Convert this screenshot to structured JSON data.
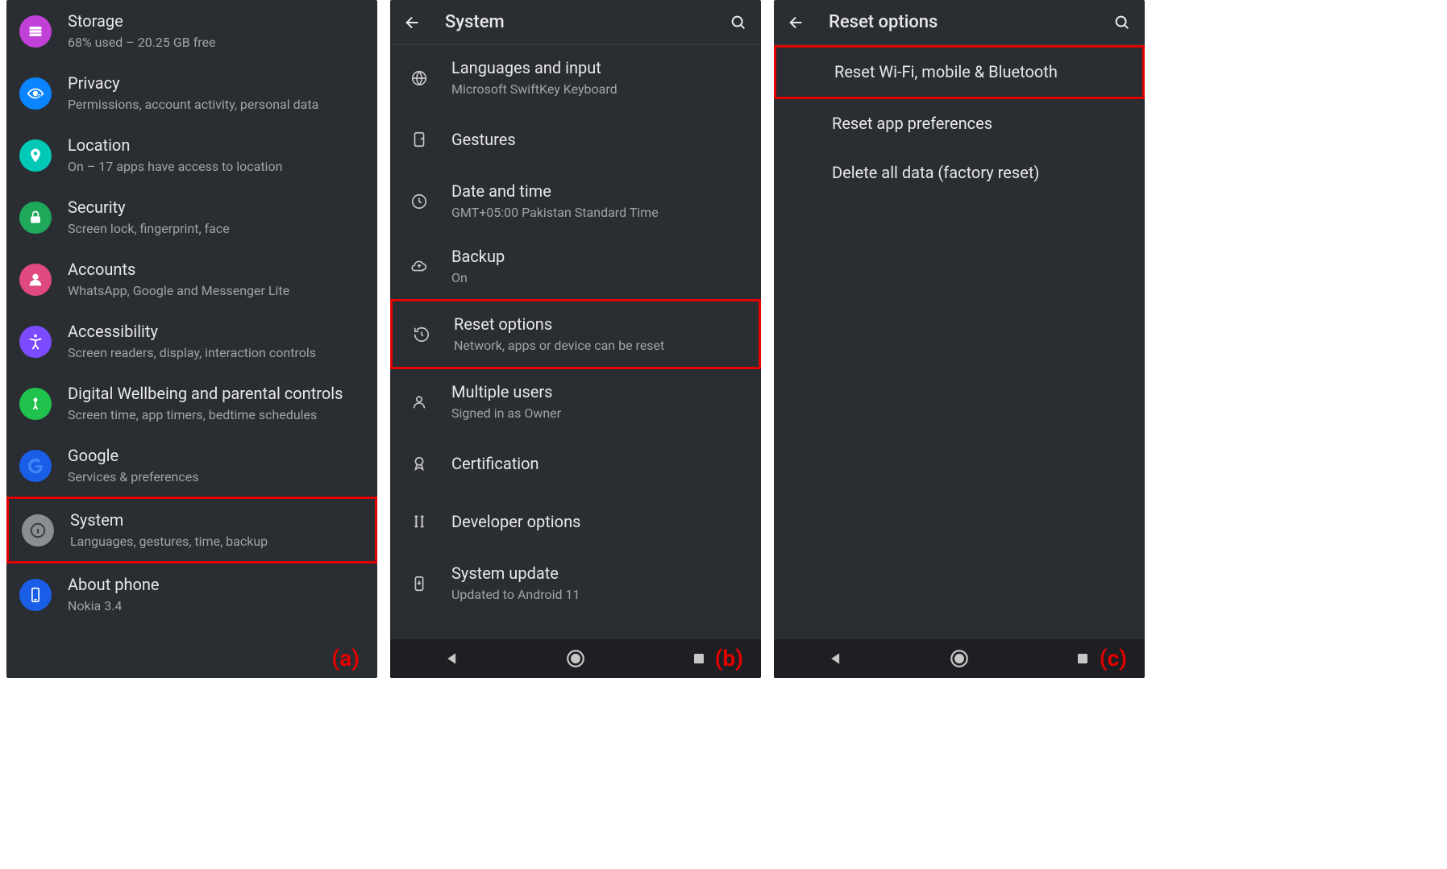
{
  "panel_a": {
    "tag": "(a)",
    "items": [
      {
        "title": "Storage",
        "sub": "68% used – 20.25 GB free",
        "icon": "storage",
        "bg": "#c040d8"
      },
      {
        "title": "Privacy",
        "sub": "Permissions, account activity, personal data",
        "icon": "privacy",
        "bg": "#0a84ff"
      },
      {
        "title": "Location",
        "sub": "On – 17 apps have access to location",
        "icon": "location",
        "bg": "#00c9b7"
      },
      {
        "title": "Security",
        "sub": "Screen lock, fingerprint, face",
        "icon": "lock",
        "bg": "#1fa85a"
      },
      {
        "title": "Accounts",
        "sub": "WhatsApp, Google and Messenger Lite",
        "icon": "account",
        "bg": "#e04980"
      },
      {
        "title": "Accessibility",
        "sub": "Screen readers, display, interaction controls",
        "icon": "accessibility",
        "bg": "#7a4bff"
      },
      {
        "title": "Digital Wellbeing and parental controls",
        "sub": "Screen time, app timers, bedtime schedules",
        "icon": "wellbeing",
        "bg": "#1fc24d"
      },
      {
        "title": "Google",
        "sub": "Services & preferences",
        "icon": "google",
        "bg": "#1a5ee8"
      },
      {
        "title": "System",
        "sub": "Languages, gestures, time, backup",
        "icon": "info",
        "bg": "#8a8d91",
        "hilite": true
      },
      {
        "title": "About phone",
        "sub": "Nokia 3.4",
        "icon": "phone",
        "bg": "#1a5ee8"
      }
    ]
  },
  "panel_b": {
    "tag": "(b)",
    "title": "System",
    "items": [
      {
        "title": "Languages and input",
        "sub": "Microsoft SwiftKey Keyboard",
        "icon": "globe"
      },
      {
        "title": "Gestures",
        "sub": "",
        "icon": "gestures"
      },
      {
        "title": "Date and time",
        "sub": "GMT+05:00 Pakistan Standard Time",
        "icon": "clock"
      },
      {
        "title": "Backup",
        "sub": "On",
        "icon": "backup"
      },
      {
        "title": "Reset options",
        "sub": "Network, apps or device can be reset",
        "icon": "reset",
        "hilite": true
      },
      {
        "title": "Multiple users",
        "sub": "Signed in as Owner",
        "icon": "person"
      },
      {
        "title": "Certification",
        "sub": "",
        "icon": "cert"
      },
      {
        "title": "Developer options",
        "sub": "",
        "icon": "dev"
      },
      {
        "title": "System update",
        "sub": "Updated to Android 11",
        "icon": "update"
      }
    ]
  },
  "panel_c": {
    "tag": "(c)",
    "title": "Reset options",
    "items": [
      {
        "title": "Reset Wi-Fi, mobile & Bluetooth",
        "hilite": true
      },
      {
        "title": "Reset app preferences"
      },
      {
        "title": "Delete all data (factory reset)"
      }
    ]
  }
}
